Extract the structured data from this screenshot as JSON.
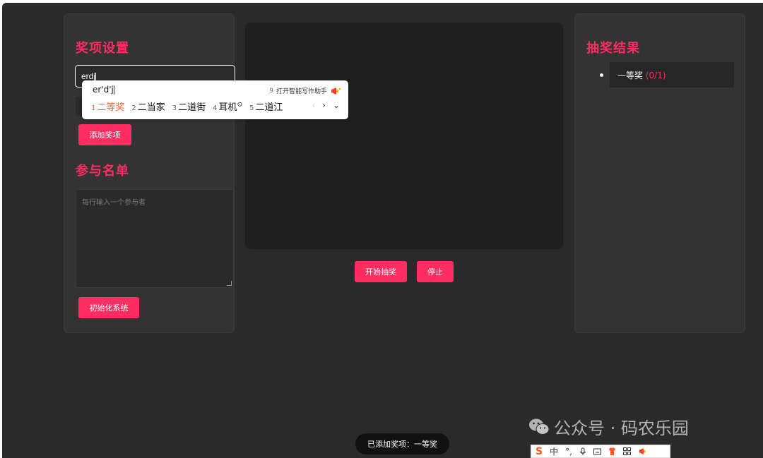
{
  "settings": {
    "title": "奖项设置",
    "prize_input_value": "erdj",
    "add_prize_label": "添加奖项"
  },
  "participants": {
    "title": "参与名单",
    "placeholder": "每行输入一个参与者",
    "init_label": "初始化系统"
  },
  "controls": {
    "start_label": "开始抽奖",
    "stop_label": "停止"
  },
  "results": {
    "title": "抽奖结果",
    "items": [
      {
        "name": "一等奖",
        "count": "(0/1)"
      }
    ]
  },
  "toast": "已添加奖项：一等奖",
  "ime": {
    "pinyin": "er'd'j",
    "assistant_index": "9",
    "assistant_label": "打开智能写作助手",
    "candidates": [
      {
        "index": "1",
        "text": "二等奖"
      },
      {
        "index": "2",
        "text": "二当家"
      },
      {
        "index": "3",
        "text": "二道街"
      },
      {
        "index": "4",
        "text": "耳机"
      },
      {
        "index": "5",
        "text": "二道江"
      }
    ]
  },
  "watermark": "公众号 · 码农乐园",
  "ime_toolbar": {
    "mode": "中",
    "punct": "°,"
  },
  "colors": {
    "accent": "#ff2d61",
    "background": "#2a2a2a",
    "panel": "#333333",
    "ime_highlight": "#ff6a2b"
  }
}
